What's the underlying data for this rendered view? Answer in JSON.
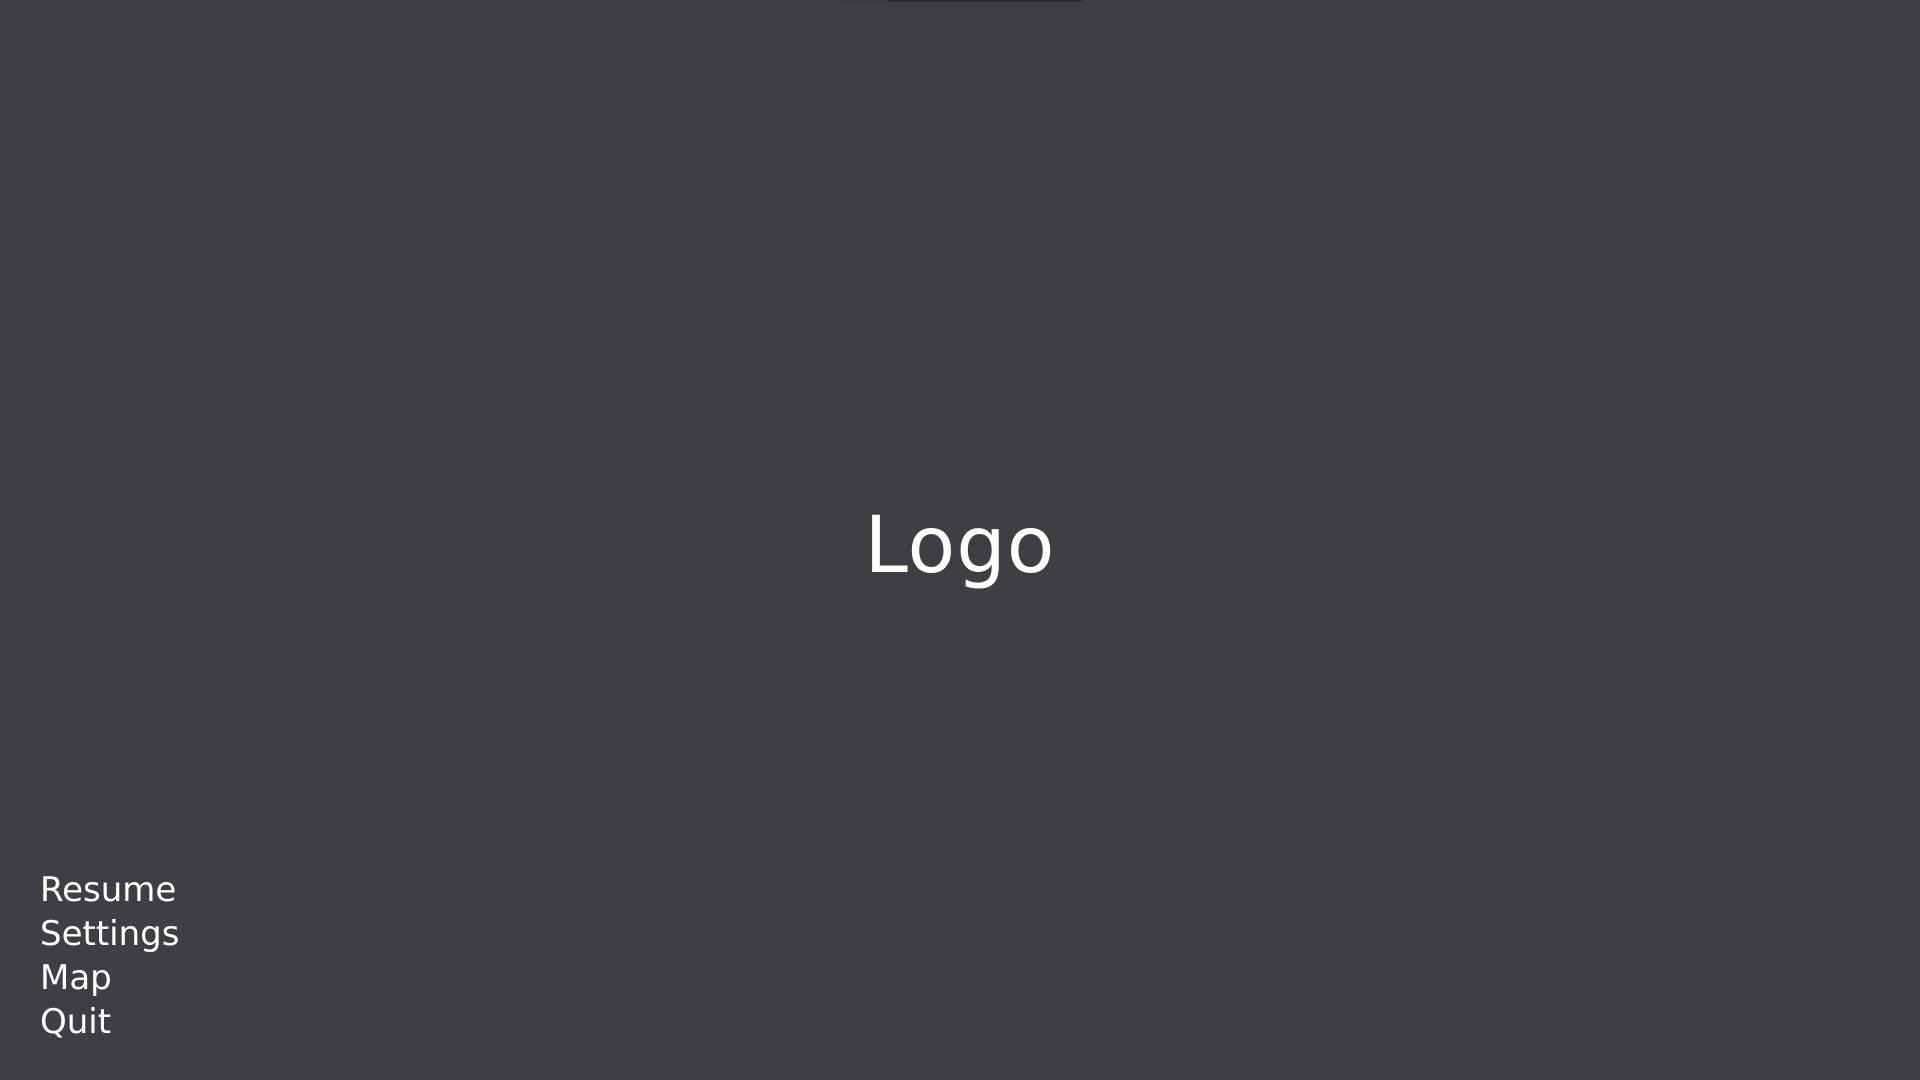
{
  "screen": {
    "background_color": "#3e3f45",
    "text_color": "#ffffff"
  },
  "logo": {
    "text": "Logo"
  },
  "menu": {
    "items": [
      {
        "label": "Resume"
      },
      {
        "label": "Settings"
      },
      {
        "label": "Map"
      },
      {
        "label": "Quit"
      }
    ]
  }
}
